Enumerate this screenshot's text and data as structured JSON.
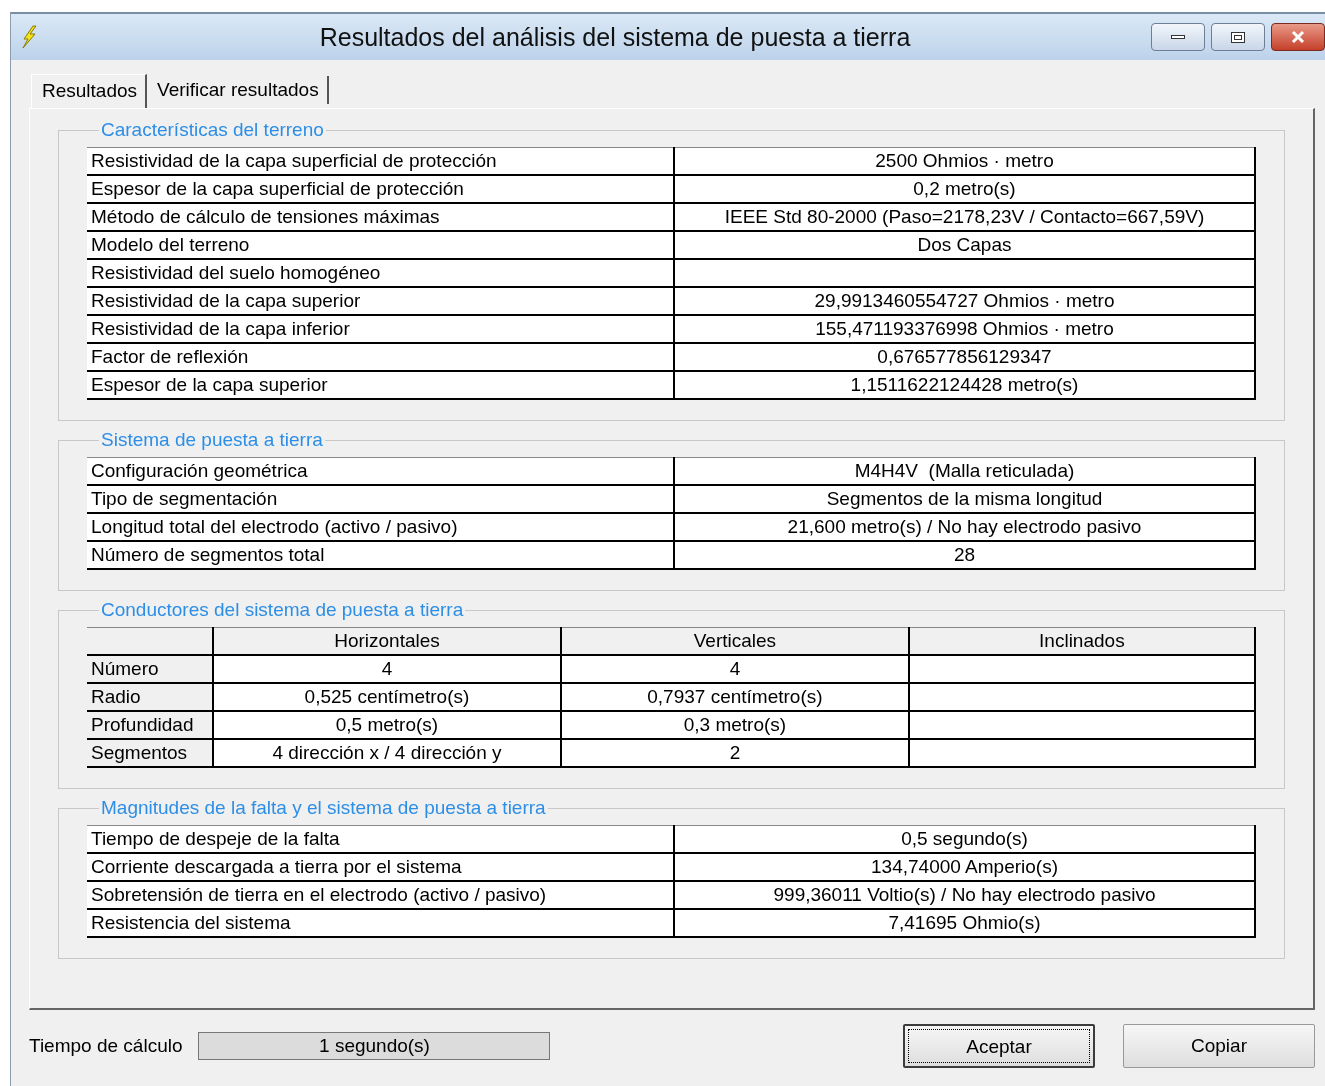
{
  "window": {
    "title": "Resultados del análisis del sistema de puesta a tierra"
  },
  "tabs": [
    {
      "label": "Resultados",
      "selected": true
    },
    {
      "label": "Verificar resultados",
      "selected": false
    }
  ],
  "groups": [
    {
      "kind": "pairs",
      "title": "Características del terreno",
      "rows": [
        {
          "label": "Resistividad de la capa superficial de protección",
          "value": "2500 Ohmios · metro"
        },
        {
          "label": "Espesor de la capa superficial de protección",
          "value": "0,2 metro(s)"
        },
        {
          "label": "Método de cálculo de tensiones máximas",
          "value": "IEEE Std 80-2000 (Paso=2178,23V / Contacto=667,59V)"
        },
        {
          "label": "Modelo del terreno",
          "value": "Dos Capas"
        },
        {
          "label": "Resistividad del suelo homogéneo"
        },
        {
          "label": "Resistividad de la capa superior",
          "value": "29,9913460554727 Ohmios · metro"
        },
        {
          "label": "Resistividad de la capa inferior",
          "value": "155,471193376998 Ohmios · metro"
        },
        {
          "label": "Factor de reflexión",
          "value": "0,676577856129347"
        },
        {
          "label": "Espesor de la capa superior",
          "value": "1,1511622124428 metro(s)"
        }
      ]
    },
    {
      "kind": "pairs",
      "title": "Sistema de puesta a tierra",
      "rows": [
        {
          "label": "Configuración geométrica",
          "value": "M4H4V  (Malla reticulada)"
        },
        {
          "label": "Tipo de segmentación",
          "value": "Segmentos de la misma longitud"
        },
        {
          "label": "Longitud total del electrodo (activo / pasivo)",
          "value": "21,600 metro(s) / No hay electrodo pasivo"
        },
        {
          "label": "Número de segmentos total",
          "value": "28"
        }
      ]
    },
    {
      "kind": "grid",
      "title": "Conductores del sistema de puesta a tierra",
      "columns": [
        "Horizontales",
        "Verticales",
        "Inclinados"
      ],
      "rows": [
        {
          "label": "Número",
          "cells": [
            "4",
            "4"
          ]
        },
        {
          "label": "Radio",
          "cells": [
            "0,525 centímetro(s)",
            "0,7937 centímetro(s)"
          ]
        },
        {
          "label": "Profundidad",
          "cells": [
            "0,5 metro(s)",
            "0,3 metro(s)"
          ]
        },
        {
          "label": "Segmentos",
          "cells": [
            "4 dirección x / 4 dirección y",
            "2"
          ]
        }
      ]
    },
    {
      "kind": "pairs",
      "title": "Magnitudes de la falta y el sistema de puesta a tierra",
      "rows": [
        {
          "label": "Tiempo de despeje de la falta",
          "value": "0,5 segundo(s)"
        },
        {
          "label": "Corriente descargada a tierra por el sistema",
          "value": "134,74000 Amperio(s)"
        },
        {
          "label": "Sobretensión de tierra en el electrodo (activo / pasivo)",
          "value": "999,36011 Voltio(s) / No hay electrodo pasivo"
        },
        {
          "label": "Resistencia del sistema",
          "value": "7,41695 Ohmio(s)"
        }
      ]
    }
  ],
  "footer": {
    "label": "Tiempo de cálculo",
    "value": "1 segundo(s)"
  },
  "buttons": [
    {
      "label": "Aceptar",
      "default": true
    },
    {
      "label": "Copiar",
      "default": false
    }
  ]
}
